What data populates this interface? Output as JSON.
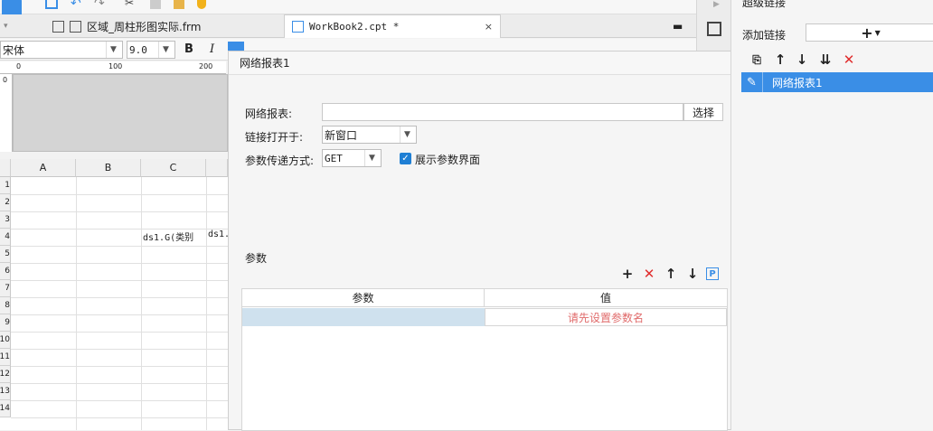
{
  "tabs": [
    {
      "label": "区域_周柱形图实际.frm",
      "active": false
    },
    {
      "label": "WorkBook2.cpt *",
      "active": true
    }
  ],
  "format": {
    "font": "宋体",
    "size": "9.0"
  },
  "ruler": {
    "marks": [
      "0",
      "100",
      "200"
    ]
  },
  "grid": {
    "columns": [
      "A",
      "B",
      "C"
    ],
    "rows": [
      "1",
      "2",
      "3",
      "4",
      "5",
      "6",
      "7",
      "8",
      "9",
      "10",
      "11",
      "12",
      "13",
      "14"
    ],
    "cells": {
      "c4": "ds1.G(类别",
      "d4": "ds1."
    }
  },
  "dialog": {
    "title": "网络报表1",
    "report_label": "网络报表:",
    "report_value": "",
    "select_button": "选择",
    "open_in_label": "链接打开于:",
    "open_in_value": "新窗口",
    "method_label": "参数传递方式:",
    "method_value": "GET",
    "show_param_label": "展示参数界面",
    "show_param_checked": true,
    "params_group": "参数",
    "param_col": "参数",
    "value_col": "值",
    "value_placeholder": "请先设置参数名"
  },
  "right_panel": {
    "title": "超级链接",
    "add_label": "添加链接",
    "items": [
      {
        "label": "网络报表1",
        "selected": true
      }
    ]
  },
  "colors": {
    "accent": "#3a8ee6",
    "delete": "#e02d2d",
    "placeholder": "#e06b6b"
  }
}
